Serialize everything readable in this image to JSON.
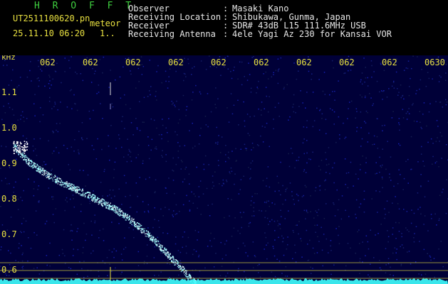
{
  "header": {
    "app_name": "H R O F F T",
    "filename": "UT2511100620.pn",
    "tag": "meteor",
    "datetime": "25.11.10 06:20",
    "index": "1..",
    "info": [
      {
        "label": "Observer",
        "sep": ":",
        "value": "Masaki Kano"
      },
      {
        "label": "Receiving Location",
        "sep": ":",
        "value": "Shibukawa, Gunma, Japan"
      },
      {
        "label": "Receiver",
        "sep": ":",
        "value": "SDR# 43dB L15 111.6MHz USB"
      },
      {
        "label": "Receiving Antenna",
        "sep": ":",
        "value": "4ele Yagi Az 230 for Kansai VOR"
      }
    ]
  },
  "spectrogram": {
    "y_unit": "kHz",
    "x_ticks": [
      "062",
      "062",
      "062",
      "062",
      "062",
      "062",
      "062",
      "062",
      "062",
      "0630"
    ],
    "y_ticks": [
      "1.1",
      "1.0",
      "0.9",
      "0.8",
      "0.7",
      "0.6"
    ],
    "colors": {
      "bg": "#000040",
      "grid": "#e8e040",
      "trace": "#9fffff",
      "noise_floor": "#40ffff"
    }
  }
}
